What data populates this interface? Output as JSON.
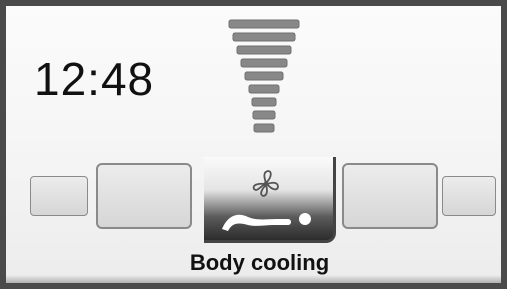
{
  "clock": {
    "time": "12:48"
  },
  "fan_speed": {
    "bars_shown": 9
  },
  "mode_selector": {
    "selected_label": "Body cooling",
    "center_icon": "fan-icon",
    "center_mode_icon": "reclining-body-cooling-icon"
  },
  "colors": {
    "background": "#f5f5f5",
    "text": "#111111",
    "tile_border": "#8a8a8a",
    "selected_tile_dark": "#2c2c2c"
  }
}
